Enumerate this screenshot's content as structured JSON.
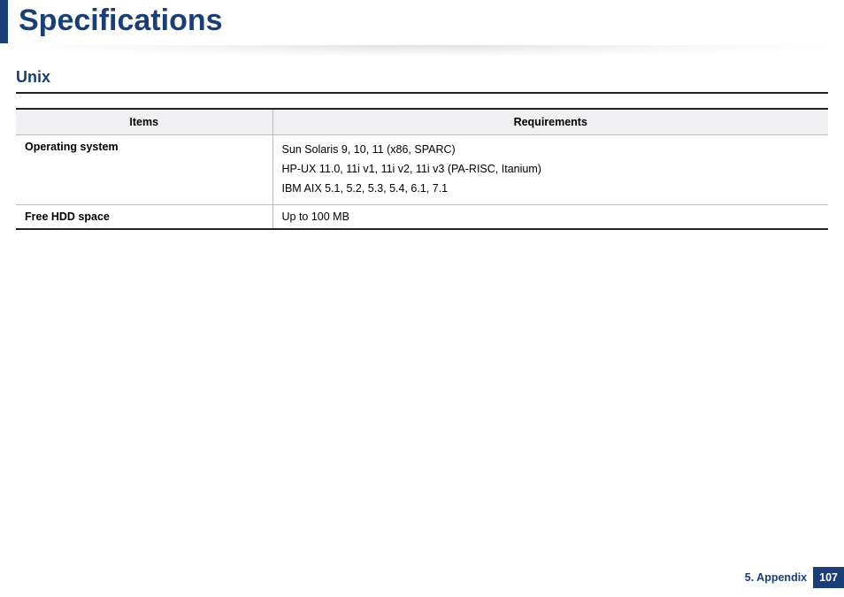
{
  "header": {
    "title": "Specifications"
  },
  "section": {
    "title": "Unix",
    "table": {
      "headers": {
        "items": "Items",
        "requirements": "Requirements"
      },
      "rows": [
        {
          "item": "Operating system",
          "requirements": [
            "Sun Solaris 9, 10, 11 (x86, SPARC)",
            "HP-UX 11.0, 11i v1, 11i v2, 11i v3 (PA-RISC, Itanium)",
            "IBM AIX 5.1, 5.2, 5.3, 5.4, 6.1, 7.1"
          ]
        },
        {
          "item": "Free HDD space",
          "requirements": [
            "Up to 100 MB"
          ]
        }
      ]
    }
  },
  "footer": {
    "chapter": "5. Appendix",
    "page": "107"
  }
}
